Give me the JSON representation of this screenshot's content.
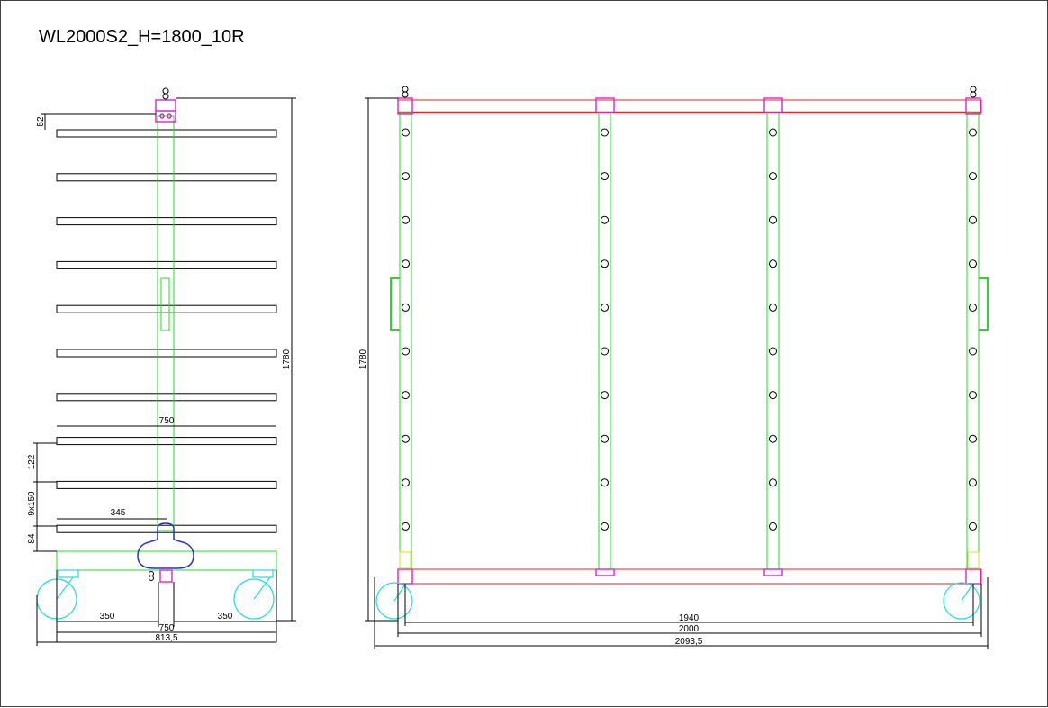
{
  "title": "WL2000S2_H=1800_10R",
  "side_view": {
    "dims": {
      "top_offset": "52",
      "height": "1780",
      "shelf_width": "750",
      "shelf_gap": "122",
      "pitch": "9x150",
      "half_shelf": "345",
      "bottom_offset": "84",
      "wheel_left": "350",
      "wheel_right": "350",
      "base_width": "750",
      "overall_width": "813,5"
    },
    "shelf_count": 10
  },
  "front_view": {
    "dims": {
      "height": "1780",
      "inner_width": "1940",
      "frame_width": "2000",
      "overall_width": "2093,5"
    },
    "post_count": 4,
    "holes_per_post": 10
  },
  "colors": {
    "frame": "#22dd22",
    "rail": "#ee2222",
    "bracket": "#dd22cc",
    "wheel": "#22dddd",
    "handle": "#2233cc",
    "dimension": "#000000"
  }
}
